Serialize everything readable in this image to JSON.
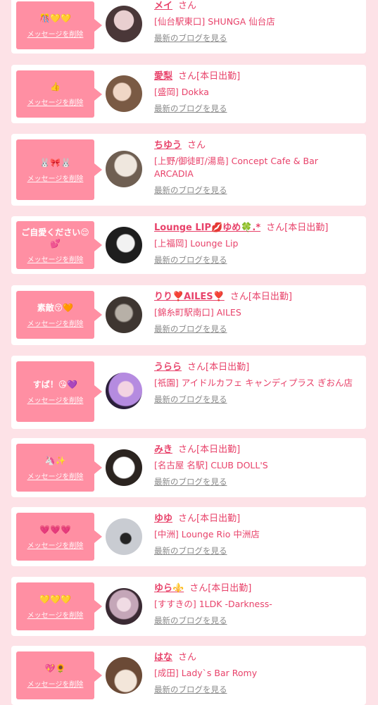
{
  "entries": [
    {
      "stamp": "🎊💛💛",
      "delete_label": "メッセージを削除",
      "name": "メイ",
      "suffix": "さん",
      "status": "",
      "shop": "[仙台駅東口] SHUNGA 仙台店",
      "blog_label": "最新のブログを見る",
      "avatar_colors": [
        "#e9cfd0",
        "#4a3738"
      ]
    },
    {
      "stamp": "👍",
      "delete_label": "メッセージを削除",
      "name": "愛梨",
      "suffix": "さん",
      "status": "[本日出勤]",
      "shop": "[盛岡] Dokka",
      "blog_label": "最新のブログを見る",
      "avatar_colors": [
        "#f0d7c6",
        "#7a5a44"
      ]
    },
    {
      "stamp": "🐰🎀🐰",
      "delete_label": "メッセージを削除",
      "name": "ちゆう",
      "suffix": "さん",
      "status": "",
      "shop": "[上野/御徒町/湯島] Concept Cafe & Bar ARCADIA",
      "blog_label": "最新のブログを見る",
      "avatar_colors": [
        "#efe7de",
        "#6f5f52"
      ]
    },
    {
      "stamp": "ご自愛ください😌💕",
      "delete_label": "メッセージを削除",
      "name": "Lounge LIP💋ゆめ🍀.*",
      "suffix": "さん",
      "status": "[本日出勤]",
      "shop": "[上福岡] Lounge Lip",
      "blog_label": "最新のブログを見る",
      "avatar_colors": [
        "#f2f2f2",
        "#1e1e1e"
      ]
    },
    {
      "stamp": "素敵😚🧡",
      "delete_label": "メッセージを削除",
      "name": "りり❣️AILES❣️",
      "suffix": "さん",
      "status": "[本日出勤]",
      "shop": "[錦糸町駅南口] AILES",
      "blog_label": "最新のブログを見る",
      "avatar_colors": [
        "#b7b0a7",
        "#3e3631"
      ]
    },
    {
      "stamp": "すば！😘💜",
      "delete_label": "メッセージを削除",
      "name": "うらら",
      "suffix": "さん",
      "status": "[本日出勤]",
      "shop": "[祇園] アイドルカフェ キャンディプラス ぎおん店",
      "blog_label": "最新のブログを見る",
      "avatar_colors": [
        "#b58be0",
        "#2a1e3a"
      ]
    },
    {
      "stamp": "🦄✨",
      "delete_label": "メッセージを削除",
      "name": "みき",
      "suffix": "さん",
      "status": "[本日出勤]",
      "shop": "[名古屋 名駅] CLUB DOLL'S",
      "blog_label": "最新のブログを見る",
      "avatar_colors": [
        "#ffffff",
        "#2b2420"
      ]
    },
    {
      "stamp": "💗💗💗",
      "delete_label": "メッセージを削除",
      "name": "ゆゆ",
      "suffix": "さん",
      "status": "[本日出勤]",
      "shop": "[中洲] Lounge Rio 中洲店",
      "blog_label": "最新のブログを見る",
      "avatar_colors": [
        "#c9ccd2",
        "#242424"
      ]
    },
    {
      "stamp": "💛💛💛",
      "delete_label": "メッセージを削除",
      "name": "ゆら⚜️",
      "suffix": "さん",
      "status": "[本日出勤]",
      "shop": "[すすきの] 1LDK -Darkness-",
      "blog_label": "最新のブログを見る",
      "avatar_colors": [
        "#c4a6b8",
        "#3a2a33"
      ]
    },
    {
      "stamp": "💖🌻",
      "delete_label": "メッセージを削除",
      "name": "はな",
      "suffix": "さん",
      "status": "",
      "shop": "[成田] Lady`s Bar Romy",
      "blog_label": "最新のブログを見る",
      "avatar_colors": [
        "#6b4a36",
        "#f3e6da"
      ]
    }
  ]
}
